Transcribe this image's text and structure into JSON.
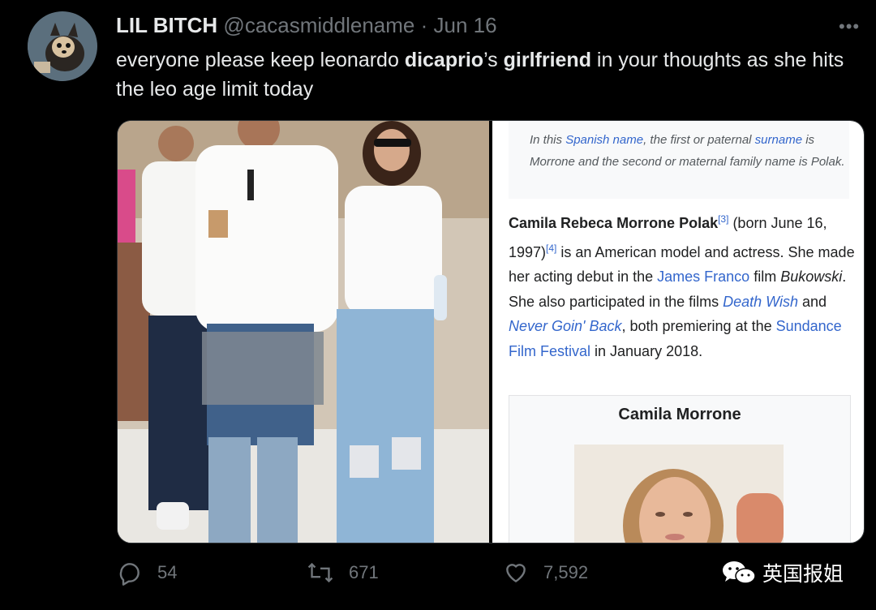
{
  "tweet": {
    "display_name": "LIL BITCH",
    "handle": "@cacasmiddlename",
    "separator": "·",
    "date": "Jun 16",
    "more": "•••",
    "text_parts": {
      "p1": "everyone please keep leonardo ",
      "p2": "dicaprio",
      "p3": "’s ",
      "p4": "girlfriend",
      "p5": " in your thoughts as she hits the leo age limit today"
    }
  },
  "wiki": {
    "hatnote": {
      "a": "In this ",
      "link1": "Spanish name",
      "b": ", the first or paternal ",
      "link2": "surname",
      "c": " is Morrone and the second or maternal family name is Polak."
    },
    "para": {
      "name_bold": "Camila Rebeca Morrone Polak",
      "ref1": "[3]",
      "t1": " (born June 16, 1997)",
      "ref2": "[4]",
      "t2": " is an American model and actress. She made her acting debut in the ",
      "link_franco": "James Franco",
      "t3": " film ",
      "bukowski": "Bukowski",
      "t4": ". She also participated in the films ",
      "link_death": "Death Wish",
      "t5": " and ",
      "link_never": "Never Goin' Back",
      "t6": ", both premiering at the ",
      "link_sundance": "Sundance Film Festival",
      "t7": " in January 2018."
    },
    "infobox_title": "Camila Morrone"
  },
  "actions": {
    "reply_count": "54",
    "retweet_count": "671",
    "like_count": "7,592"
  },
  "watermark": "英国报姐",
  "colors": {
    "background": "#000000",
    "text": "#e7e9ea",
    "muted": "#71767b",
    "wiki_link": "#3366cc"
  }
}
